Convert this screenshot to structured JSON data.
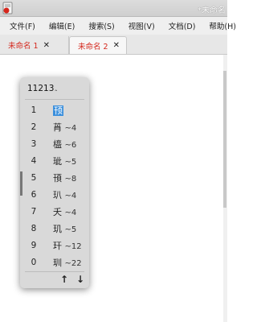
{
  "window": {
    "title": "*未命名"
  },
  "menubar": {
    "items": [
      {
        "label": "文件(F)"
      },
      {
        "label": "编辑(E)"
      },
      {
        "label": "搜索(S)"
      },
      {
        "label": "视图(V)"
      },
      {
        "label": "文档(D)"
      },
      {
        "label": "帮助(H)"
      }
    ]
  },
  "tabs": [
    {
      "label": "未命名 1",
      "close": "✕",
      "active": false
    },
    {
      "label": "未命名 2",
      "close": "✕",
      "active": true
    }
  ],
  "ime": {
    "preedit": "11213",
    "caret": "‸",
    "candidates": [
      {
        "num": "1",
        "text": "顸",
        "code": ""
      },
      {
        "num": "2",
        "text": "莦",
        "code": "~4"
      },
      {
        "num": "3",
        "text": "橀",
        "code": "~6"
      },
      {
        "num": "4",
        "text": "玼",
        "code": "~5"
      },
      {
        "num": "5",
        "text": "頇",
        "code": "~8"
      },
      {
        "num": "6",
        "text": "玐",
        "code": "~4"
      },
      {
        "num": "7",
        "text": "夭",
        "code": "~4"
      },
      {
        "num": "8",
        "text": "玑",
        "code": "~5"
      },
      {
        "num": "9",
        "text": "玕",
        "code": "~12"
      },
      {
        "num": "0",
        "text": "玔",
        "code": "~22"
      }
    ],
    "prev_page": "↑",
    "next_page": "↓"
  },
  "colors": {
    "tab_label": "#d4271c",
    "highlight": "#3b8fdc",
    "popup_bg": "#d9d9d9"
  }
}
